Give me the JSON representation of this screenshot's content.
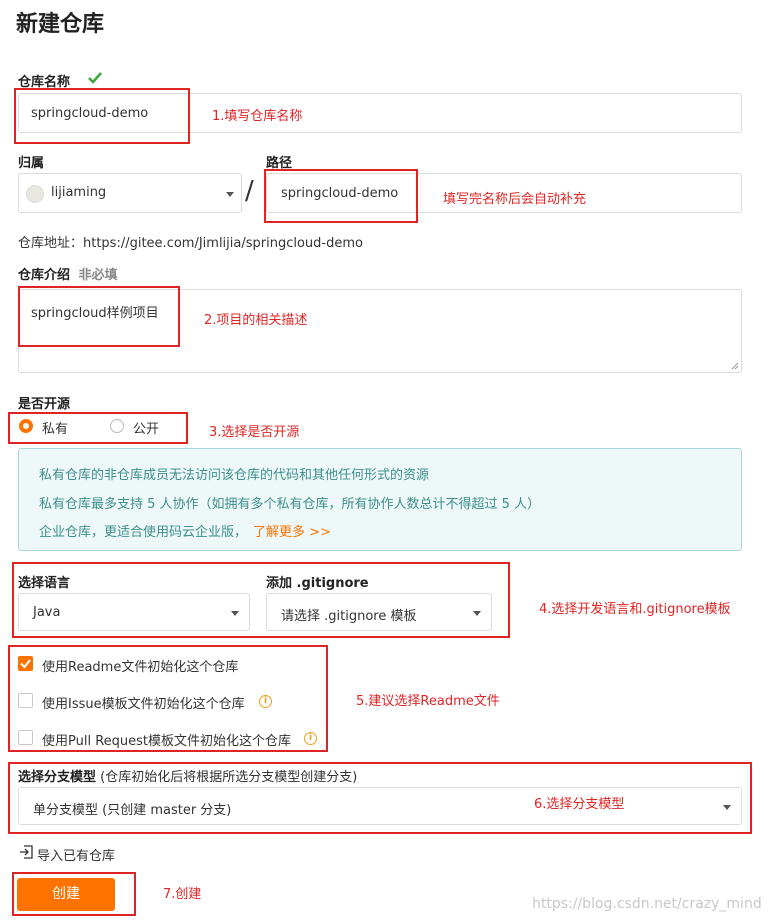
{
  "page_title": "新建仓库",
  "repo_name": {
    "label": "仓库名称",
    "value": "springcloud-demo",
    "annotation": "1.填写仓库名称"
  },
  "owner": {
    "label": "归属",
    "value": "lijiaming"
  },
  "slash": "/",
  "path": {
    "label": "路径",
    "value": "springcloud-demo",
    "annotation": "填写完名称后会自动补充"
  },
  "repo_address": "仓库地址：https://gitee.com/Jimlijia/springcloud-demo",
  "description": {
    "label": "仓库介绍",
    "optional": "非必填",
    "value": "springcloud样例项目",
    "annotation": "2.项目的相关描述"
  },
  "visibility": {
    "label": "是否开源",
    "private": "私有",
    "public": "公开",
    "selected": "private",
    "annotation": "3.选择是否开源"
  },
  "notice": {
    "line1": "私有仓库的非仓库成员无法访问该仓库的代码和其他任何形式的资源",
    "line2": "私有仓库最多支持 5 人协作（如拥有多个私有仓库，所有协作人数总计不得超过 5 人）",
    "line3": "企业仓库，更适合使用码云企业版，",
    "link": "了解更多 >>"
  },
  "language": {
    "label": "选择语言",
    "value": "Java"
  },
  "gitignore": {
    "label": "添加 .gitignore",
    "value": "请选择 .gitignore 模板",
    "annotation": "4.选择开发语言和.gitignore模板"
  },
  "init_options": {
    "readme": {
      "label": "使用Readme文件初始化这个仓库",
      "checked": true
    },
    "issue": {
      "label": "使用Issue模板文件初始化这个仓库",
      "checked": false
    },
    "pr": {
      "label": "使用Pull Request模板文件初始化这个仓库",
      "checked": false
    },
    "annotation": "5.建议选择Readme文件"
  },
  "branch": {
    "label": "选择分支模型",
    "hint": "(仓库初始化后将根据所选分支模型创建分支)",
    "value": "单分支模型 (只创建 master 分支)",
    "annotation": "6.选择分支模型"
  },
  "import_link": "导入已有仓库",
  "create_button": "创建",
  "create_annotation": "7.创建",
  "watermark": "https://blog.csdn.net/crazy_mind",
  "colors": {
    "accent": "#fe7300",
    "annotation_red": "#e02424",
    "check_green": "#3aa83a",
    "notice_bg": "#eef8f8",
    "notice_border": "#a9d8d6",
    "notice_text": "#3c8f8a"
  }
}
